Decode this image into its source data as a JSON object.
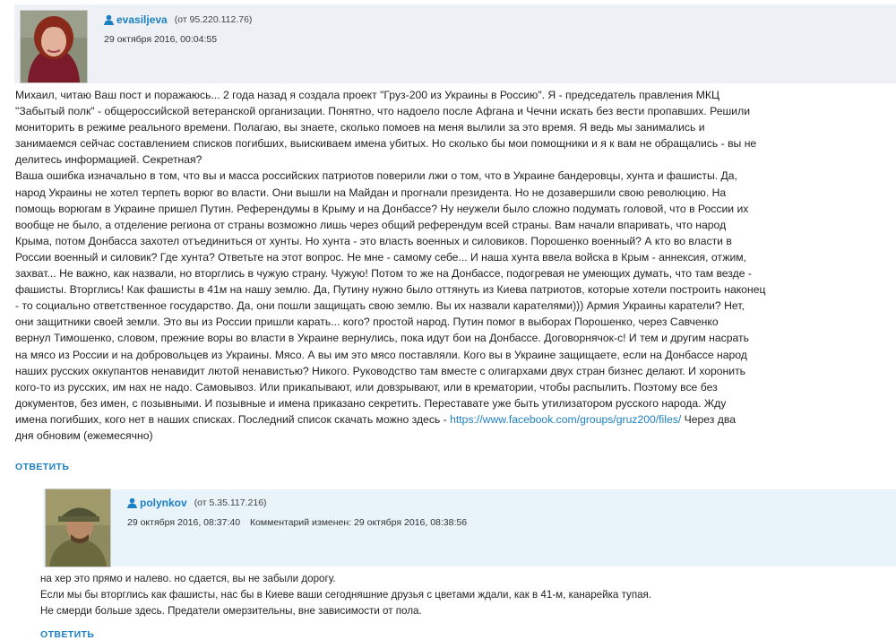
{
  "comments": [
    {
      "username": "evasiljeva",
      "ip": "(от 95.220.112.76)",
      "date": "29 октября 2016, 00:04:55",
      "lines": [
        "Михаил, читаю Ваш пост и поражаюсь... 2 года назад я создала проект \"Груз-200 из Украины в Россию\". Я - председатель правления МКЦ",
        "\"Забытый полк\" - общероссийской ветеранской организации. Понятно, что надоело после Афгана и Чечни искать без вести пропавших. Решили",
        "мониторить в режиме реального времени. Полагаю, вы знаете, сколько помоев на меня вылили за это время. Я ведь мы занимались и",
        "занимаемся сейчас составлением списков погибших, выискиваем имена убитых. Но сколько бы мои помощники и я к вам не обращались - вы не",
        "делитесь информацией. Секретная?",
        "Ваша ошибка изначально в том, что вы и масса российских патриотов поверили лжи о том, что в Украине бандеровцы, хунта и фашисты. Да,",
        "народ Украины не хотел терпеть ворюг во власти. Они вышли на Майдан и прогнали президента. Но не дозавершили свою революцию. На",
        "помощь ворюгам в Украине пришел Путин. Референдумы в Крыму и на Донбассе? Ну неужели было сложно подумать головой, что в России их",
        "вообще не было, а отделение региона от страны возможно лишь через общий референдум всей страны. Вам начали впаривать, что народ",
        "Крыма, потом Донбасса захотел отъединиться от хунты. Но хунта - это власть военных и силовиков. Порошенко военный? А кто во власти в",
        "России военный и силовик? Где хунта? Ответьте на этот вопрос. Не мне - самому себе... И наша хунта ввела войска в Крым - аннексия, отжим,",
        "захват... Не важно, как назвали, но вторглись в чужую страну. Чужую! Потом то же на Донбассе, подогревая не умеющих думать, что там везде -",
        "фашисты. Вторглись! Как фашисты в 41м на нашу землю. Да, Путину нужно было оттянуть из Киева патриотов, которые хотели построить наконец",
        "- то социально ответственное государство. Да, они пошли защищать свою землю. Вы их назвали карателями))) Армия Украины каратели? Нет,",
        "они защитники своей земли. Это вы из России пришли карать... кого? простой народ. Путин помог в выборах Порошенко, через Савченко",
        "вернул Тимошенко, словом, прежние воры во власти в Украине вернулись, пока идут бои на Донбассе. Договорнячок-с! И тем и другим насрать",
        "на мясо из России и на добровольцев из Украины. Мясо. А вы им это мясо поставляли. Кого вы в Украине защищаете, если на Донбассе народ",
        "наших русских оккупантов ненавидит лютой ненавистью? Никого. Руководство там вместе с олигархами двух стран бизнес делают. И хоронить",
        "кого-то из русских, им нах не надо. Самовывоз. Или прикапывают, или довзрывают, или в крематории, чтобы распылить. Поэтому все без",
        "документов, без имен, с позывными. И позывные и имена приказано секретить. Переставате уже быть утилизатором русского народа. Жду"
      ],
      "last_line_prefix": "имена погибших, кого нет в наших списках. Последний список скачать можно здесь - ",
      "link": "https://www.facebook.com/groups/gruz200/files/",
      "last_line_suffix": " Через два",
      "final_line": "дня обновим (ежемесячно)",
      "reply_label": "ОТВЕТИТЬ"
    },
    {
      "username": "polynkov",
      "ip": "(от 5.35.117.216)",
      "date": "29 октября 2016, 08:37:40",
      "edited": "Комментарий изменен:  29 октября 2016, 08:38:56",
      "lines": [
        "на хер это прямо и налево. но сдается, вы не забыли дорогу.",
        "Если мы бы вторглись как фашисты, нас бы в Киеве ваши сегодняшние друзья с цветами ждали, как в 41-м, канарейка тупая.",
        "Не смерди больше здесь. Предатели омерзительны, вне зависимости от пола."
      ],
      "reply_label": "ОТВЕТИТЬ"
    }
  ]
}
